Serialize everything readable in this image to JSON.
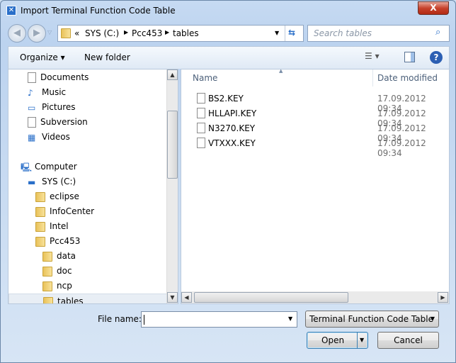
{
  "window": {
    "title": "Import Terminal Function Code Table",
    "close": "X"
  },
  "nav": {
    "back": "◀",
    "forward": "▶",
    "breadcrumb": [
      "«",
      "SYS (C:)",
      "Pcc453",
      "tables"
    ],
    "search_placeholder": "Search tables"
  },
  "toolbar": {
    "organize": "Organize ▾",
    "new_folder": "New folder",
    "help": "?"
  },
  "tree": [
    {
      "label": "Documents",
      "icon": "documents-icon",
      "level": 1
    },
    {
      "label": "Music",
      "icon": "music-icon",
      "level": 1
    },
    {
      "label": "Pictures",
      "icon": "pictures-icon",
      "level": 1
    },
    {
      "label": "Subversion",
      "icon": "subversion-icon",
      "level": 1
    },
    {
      "label": "Videos",
      "icon": "videos-icon",
      "level": 1
    },
    {
      "label": "Computer",
      "icon": "computer-icon",
      "level": 0
    },
    {
      "label": "SYS (C:)",
      "icon": "drive-icon",
      "level": 1
    },
    {
      "label": "eclipse",
      "icon": "folder-icon",
      "level": 2
    },
    {
      "label": "InfoCenter",
      "icon": "folder-icon",
      "level": 2
    },
    {
      "label": "Intel",
      "icon": "folder-icon",
      "level": 2
    },
    {
      "label": "Pcc453",
      "icon": "folder-icon",
      "level": 2
    },
    {
      "label": "data",
      "icon": "folder-icon",
      "level": 3
    },
    {
      "label": "doc",
      "icon": "folder-icon",
      "level": 3
    },
    {
      "label": "ncp",
      "icon": "folder-icon",
      "level": 3
    },
    {
      "label": "tables",
      "icon": "folder-icon",
      "level": 3,
      "selected": true
    }
  ],
  "files": {
    "columns": [
      "Name",
      "Date modified"
    ],
    "rows": [
      {
        "name": "BS2.KEY",
        "date": "17.09.2012 09:34"
      },
      {
        "name": "HLLAPI.KEY",
        "date": "17.09.2012 09:34"
      },
      {
        "name": "N3270.KEY",
        "date": "17.09.2012 09:34"
      },
      {
        "name": "VTXXX.KEY",
        "date": "17.09.2012 09:34"
      }
    ]
  },
  "footer": {
    "file_name_label": "File name:",
    "file_name_value": "",
    "file_type": "Terminal Function Code Table",
    "open": "Open",
    "cancel": "Cancel"
  }
}
